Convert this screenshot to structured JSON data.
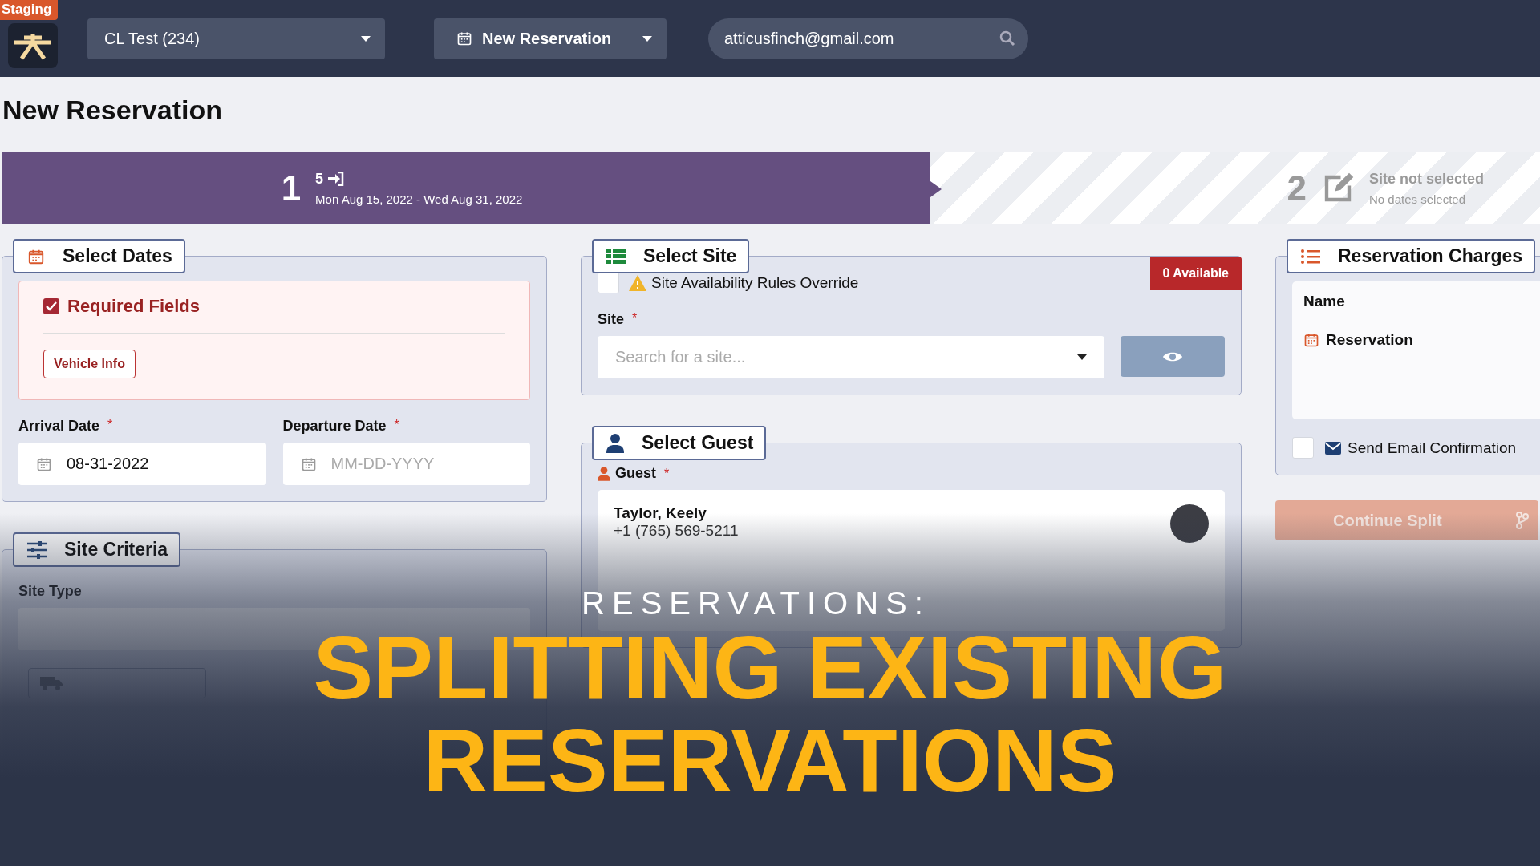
{
  "top_bar": {
    "badge": "Staging",
    "park_select": {
      "value": "CL Test (234)"
    },
    "new_button": {
      "label": "New Reservation"
    },
    "search": {
      "value": "atticusfinch@gmail.com"
    }
  },
  "page_title": "New Reservation",
  "steps": [
    {
      "number": "1",
      "heading": "5",
      "subheading": "Mon Aug 15, 2022 - Wed Aug 31, 2022",
      "selected": true
    },
    {
      "number": "2",
      "heading": "Site not selected",
      "subheading": "No dates selected",
      "selected": false
    }
  ],
  "select_dates": {
    "title": "Select Dates",
    "required": {
      "title": "Required Fields",
      "checked": true,
      "buttons": [
        "Vehicle Info"
      ]
    },
    "fields": [
      {
        "label": "Arrival Date",
        "required_mark": "*",
        "value": "08-31-2022"
      },
      {
        "label": "Departure Date",
        "required_mark": "*",
        "placeholder": "MM-DD-YYYY"
      }
    ]
  },
  "site_criteria": {
    "title": "Site Criteria",
    "site_type": {
      "label": "Site Type"
    }
  },
  "select_site": {
    "title": "Select Site",
    "availability": "0 Available",
    "override": {
      "label": "Site Availability Rules Override",
      "checked": false
    },
    "site": {
      "label": "Site",
      "required_mark": "*",
      "placeholder": "Search for a site..."
    }
  },
  "select_guest": {
    "title": "Select Guest",
    "label": "Guest",
    "required_mark": "*",
    "card": {
      "name": "Taylor, Keely",
      "phone": "+1 (765) 569-5211"
    }
  },
  "charges": {
    "title": "Reservation Charges",
    "columns": [
      "Name"
    ],
    "rows": [
      "Reservation"
    ],
    "send_email": {
      "label": "Send Email Confirmation",
      "checked": false
    },
    "continue_button": {
      "label": "Continue Split",
      "disabled": true
    }
  },
  "overlay": {
    "kicker": "RESERVATIONS:",
    "title_lines": [
      "SPLITTING EXISTING",
      "RESERVATIONS"
    ]
  }
}
